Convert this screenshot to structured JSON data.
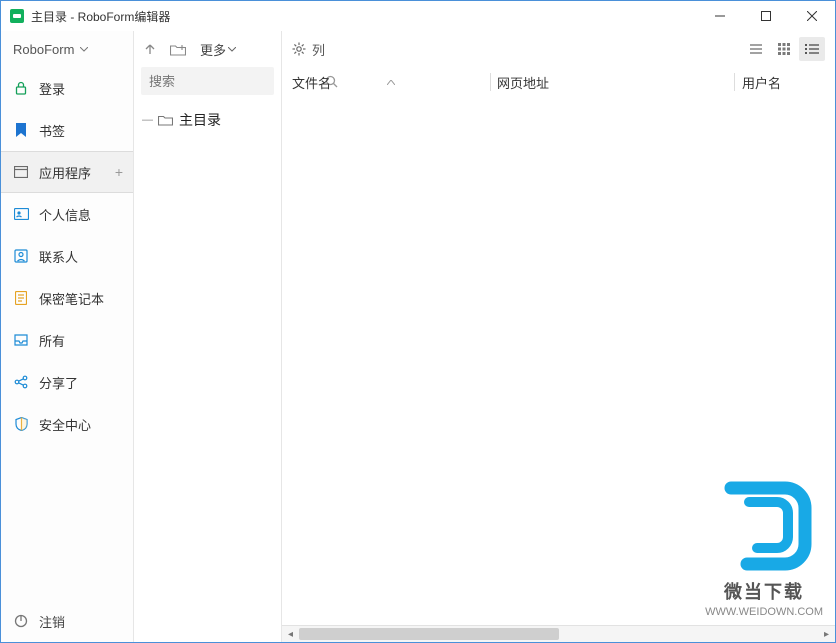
{
  "titlebar": {
    "title": "主目录 - RoboForm编辑器"
  },
  "sidebar": {
    "brand": "RoboForm",
    "items": [
      {
        "label": "登录"
      },
      {
        "label": "书签"
      },
      {
        "label": "应用程序"
      },
      {
        "label": "个人信息"
      },
      {
        "label": "联系人"
      },
      {
        "label": "保密笔记本"
      },
      {
        "label": "所有"
      },
      {
        "label": "分享了"
      },
      {
        "label": "安全中心"
      }
    ],
    "footer": "注销"
  },
  "tree": {
    "more_label": "更多",
    "search_placeholder": "搜索",
    "root_label": "主目录"
  },
  "main": {
    "view_label": "列",
    "columns": {
      "filename": "文件名",
      "url": "网页地址",
      "user": "用户名"
    }
  },
  "watermark": {
    "line1": "微当下载",
    "line2": "WWW.WEIDOWN.COM"
  }
}
